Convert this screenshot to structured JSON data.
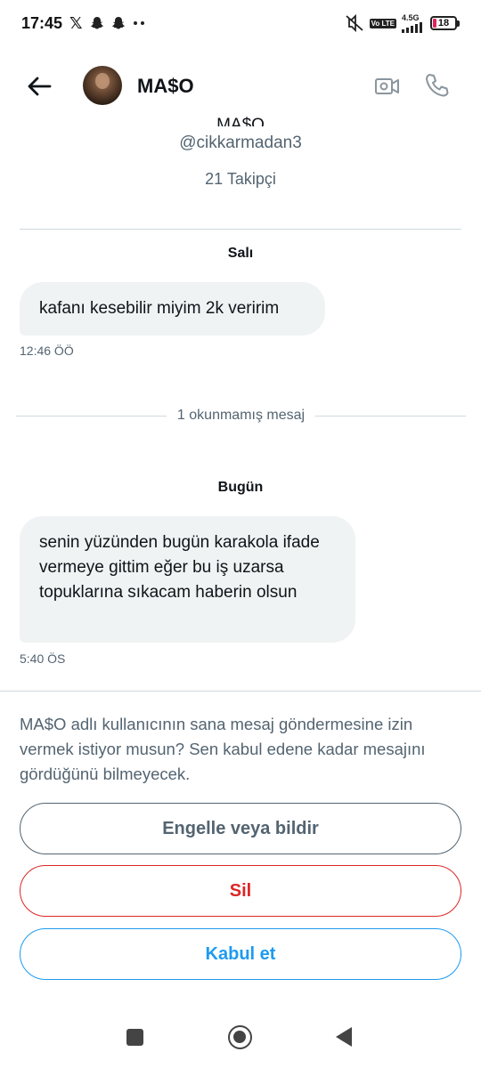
{
  "status_bar": {
    "time": "17:45",
    "notification_icons": [
      "x-icon",
      "snapchat-icon",
      "snapchat-icon",
      "more-dots-icon"
    ],
    "network": "4.5G",
    "lte": "Vo LTE",
    "battery": "18"
  },
  "header": {
    "title": "MA$O"
  },
  "profile": {
    "name": "MA$O",
    "handle": "@cikkarmadan3",
    "followers": "21 Takipçi"
  },
  "messages": {
    "day1": "Salı",
    "msg1": "kafanı kesebilir miyim 2k veririm",
    "time1": "12:46 ÖÖ",
    "unread": "1 okunmamış mesaj",
    "day2": "Bugün",
    "msg2": "senin yüzünden bugün karakola ifade vermeye gittim eğer bu iş uzarsa topuklarına sıkacam haberin olsun",
    "time2": "5:40 ÖS"
  },
  "request": {
    "text": "MA$O adlı kullanıcının sana mesaj göndermesine izin vermek istiyor musun? Sen kabul edene kadar mesajını gördüğünü bilmeyecek.",
    "block_label": "Engelle veya bildir",
    "delete_label": "Sil",
    "accept_label": "Kabul et"
  },
  "colors": {
    "accent": "#1d9bf0",
    "danger": "#dc2626",
    "secondary_text": "#536471",
    "bubble": "#eff3f4"
  }
}
